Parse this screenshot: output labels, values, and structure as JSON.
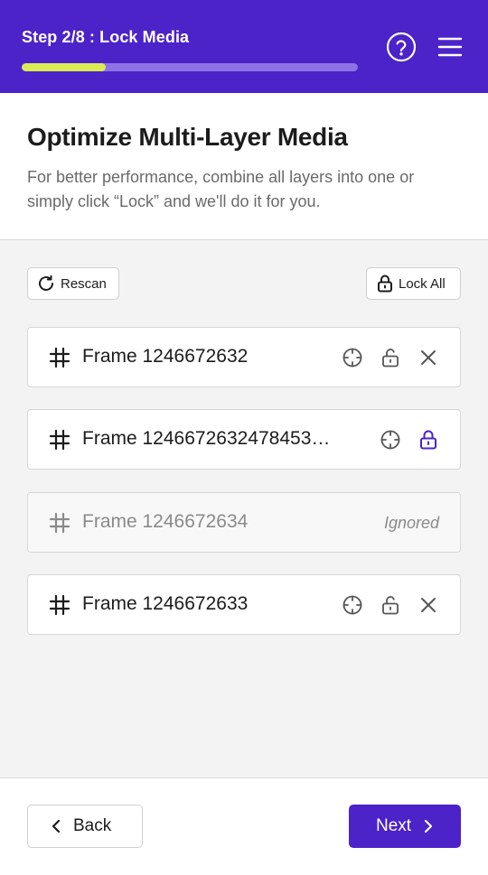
{
  "header": {
    "step_title": "Step 2/8 : Lock Media",
    "progress_fraction": 0.25,
    "accent_color": "#4c22c9",
    "progress_color": "#dcec55",
    "help_icon": "question-circle-icon",
    "menu_icon": "hamburger-menu-icon"
  },
  "intro": {
    "title": "Optimize Multi-Layer Media",
    "description": "For better performance, combine all layers into one or simply click “Lock” and we'll do it for you."
  },
  "toolbar": {
    "rescan_label": "Rescan",
    "lock_all_label": "Lock All"
  },
  "frames": [
    {
      "name": "Frame 1246672632",
      "state": "unlocked"
    },
    {
      "name": "Frame 1246672632478453…",
      "state": "locked"
    },
    {
      "name": "Frame 1246672634",
      "state": "ignored",
      "status_label": "Ignored"
    },
    {
      "name": "Frame 1246672633",
      "state": "unlocked"
    }
  ],
  "footer": {
    "back_label": "Back",
    "next_label": "Next"
  }
}
